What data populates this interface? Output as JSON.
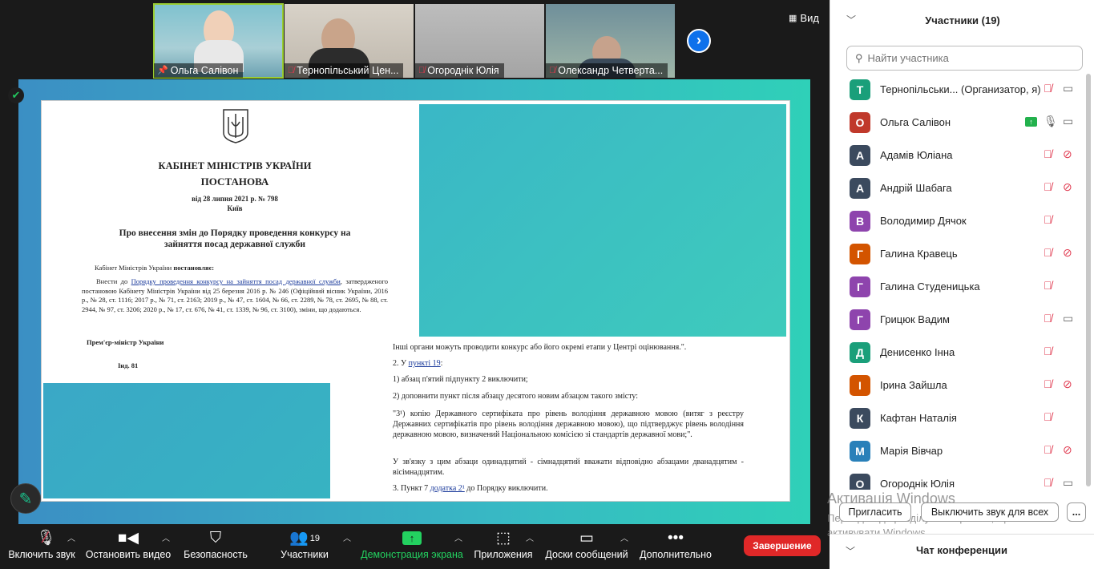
{
  "thumbnails": [
    {
      "name": "Ольга Салівон",
      "muted": false,
      "pinned": true,
      "bg": "#8fb8c8"
    },
    {
      "name": "Тернопільський Цен...",
      "muted": true,
      "pinned": false,
      "bg": "#c9c4bc"
    },
    {
      "name": "Огороднік Юлія",
      "muted": true,
      "pinned": false,
      "bg": "#b0b0b0"
    },
    {
      "name": "Олександр Четверта...",
      "muted": true,
      "pinned": false,
      "bg": "#8aa0a8"
    }
  ],
  "view_label": "Вид",
  "document": {
    "org": "КАБІНЕТ МІНІСТРІВ УКРАЇНИ",
    "type": "ПОСТАНОВА",
    "date": "від 28 липня 2021 р. № 798",
    "city": "Київ",
    "title": "Про внесення змін до Порядку проведення конкурсу на зайняття посад державної служби",
    "preamble_a": "Кабінет Міністрів України",
    "preamble_b": "постановляє:",
    "p1_a": "Внести до",
    "p1_link": "Порядку проведення конкурсу на зайняття посад державної служби",
    "p1_b": ", затвердженого постановою Кабінету Міністрів України від 25 березня 2016 р. № 246 (Офіційний вісник України, 2016 р., № 28, ст. 1116; 2017 р., № 71, ст. 2163; 2019 р., № 47, ст. 1604, № 66, ст. 2289, № 78, ст. 2695, № 88, ст. 2944, № 97, ст. 3206; 2020 р., № 17, ст. 676, № 41, ст. 1339, № 96, ст. 3100), зміни, що додаються.",
    "signer": "Прем'єр-міністр України",
    "index": "Інд. 81",
    "r1": "Інші органи можуть проводити конкурс або його окремі етапи у Центрі оцінювання.\".",
    "r2_a": "2. У",
    "r2_link": "пункті 19",
    "r2_b": ":",
    "r3": "1) абзац п'ятий підпункту 2 виключити;",
    "r4": "2) доповнити пункт після абзацу десятого новим абзацом такого змісту:",
    "r5": "\"3¹) копію Державного сертифіката про рівень володіння державною мовою (витяг з реєстру Державних сертифікатів про рівень володіння державною мовою), що підтверджує рівень володіння державною мовою, визначений Національною комісією зі стандартів державної мови;\".",
    "r6": "У зв'язку з цим абзаци одинадцятий - сімнадцятий вважати відповідно абзацами дванадцятим - вісімнадцятим.",
    "r7_a": "3. Пункт 7",
    "r7_link": "додатка 2¹",
    "r7_b": "до Порядку виключити."
  },
  "toolbar": {
    "mute": "Включить звук",
    "video": "Остановить видео",
    "security": "Безопасность",
    "participants": "Участники",
    "participants_count": "19",
    "share": "Демонстрация экрана",
    "apps": "Приложения",
    "whiteboard": "Доски сообщений",
    "more": "Дополнительно",
    "end": "Завершение"
  },
  "panel": {
    "title": "Участники (19)",
    "search_placeholder": "Найти участника",
    "participants": [
      {
        "initial": "T",
        "name": "Тернопільськи... (Организатор, я)",
        "color": "#1a9f7a",
        "mic": "muted",
        "cam": "on",
        "share": false
      },
      {
        "initial": "О",
        "name": "Ольга Салівон",
        "color": "#c0392b",
        "mic": "on",
        "cam": "on",
        "share": true
      },
      {
        "initial": "А",
        "name": "Адамів Юліана",
        "color": "#3b4a5e",
        "mic": "muted",
        "cam": "off",
        "share": false
      },
      {
        "initial": "А",
        "name": "Андрій Шабага",
        "color": "#3b4a5e",
        "mic": "muted",
        "cam": "off",
        "share": false
      },
      {
        "initial": "В",
        "name": "Володимир Дячок",
        "color": "#8e44ad",
        "mic": "muted",
        "cam": "none",
        "share": false
      },
      {
        "initial": "Г",
        "name": "Галина Кравець",
        "color": "#d35400",
        "mic": "muted",
        "cam": "off",
        "share": false
      },
      {
        "initial": "Г",
        "name": "Галина Студеницька",
        "color": "#8e44ad",
        "mic": "muted",
        "cam": "none",
        "share": false
      },
      {
        "initial": "Г",
        "name": "Грицюк Вадим",
        "color": "#8e44ad",
        "mic": "muted",
        "cam": "on",
        "share": false
      },
      {
        "initial": "Д",
        "name": "Денисенко Інна",
        "color": "#1a9f7a",
        "mic": "muted",
        "cam": "none",
        "share": false
      },
      {
        "initial": "І",
        "name": "Ірина Зайшла",
        "color": "#d35400",
        "mic": "muted",
        "cam": "off",
        "share": false
      },
      {
        "initial": "К",
        "name": "Кафтан Наталія",
        "color": "#3b4a5e",
        "mic": "muted",
        "cam": "none",
        "share": false
      },
      {
        "initial": "М",
        "name": "Марія Вівчар",
        "color": "#2980b9",
        "mic": "muted",
        "cam": "off",
        "share": false
      },
      {
        "initial": "О",
        "name": "Огороднік Юлія",
        "color": "#3b4a5e",
        "mic": "muted",
        "cam": "on",
        "share": false
      }
    ],
    "invite": "Пригласить",
    "unmute_all": "Выключить звук для всех",
    "more": "...",
    "chat": "Чат конференции",
    "watermark_title": "Активація Windows",
    "watermark_text": "Перейдіть до розділу \"Настройки\", щоб активувати Windows."
  }
}
